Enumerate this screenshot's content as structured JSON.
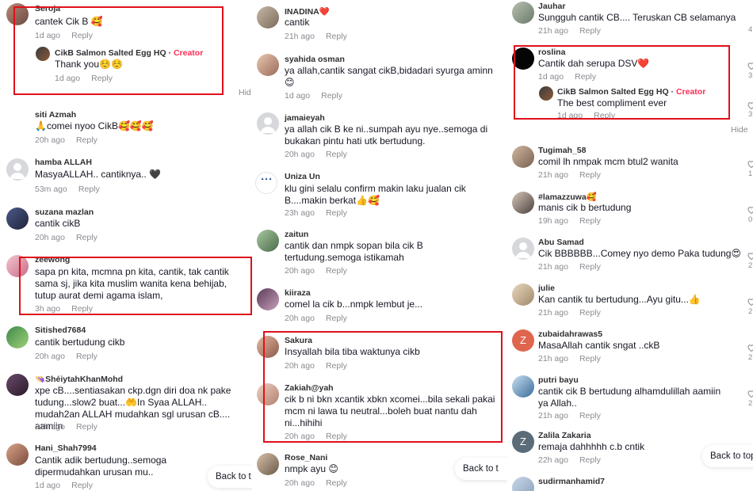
{
  "colors": {
    "highlight": "#e0101a",
    "creator": "#fe2c55",
    "meta": "#8a8b91"
  },
  "col1": {
    "comments": [
      {
        "user": "Seroja",
        "text": "cantek Cik B 🥰",
        "time": "1d ago",
        "reply": "Reply",
        "sub": {
          "user": "CikB Salmon Salted Egg HQ",
          "badge": "Creator",
          "text": "Thank you☺️☺️",
          "time": "1d ago",
          "reply": "Reply"
        }
      },
      {
        "user": "siti Azmah",
        "text": "🙏comei nyoo CikB🥰🥰🥰",
        "time": "20h ago",
        "reply": "Reply"
      },
      {
        "user": "hamba ALLAH",
        "text": "MasyaALLAH.. cantiknya.. 🖤",
        "time": "53m ago",
        "reply": "Reply"
      },
      {
        "user": "suzana mazlan",
        "text": "cantik cikB",
        "time": "20h ago",
        "reply": "Reply"
      },
      {
        "user": "zeewong",
        "text": "sapa pn kita, mcmna pn kita, cantik, tak cantik sama sj, jika kita muslim wanita kena behijab, tutup aurat demi agama islam,",
        "time": "3h ago",
        "reply": "Reply"
      },
      {
        "user": "Sitished7684",
        "text": "cantik bertudung cikb",
        "time": "20h ago",
        "reply": "Reply"
      },
      {
        "user": "👒ShéiytahKhanMohd",
        "text": "xpe cB....sentiasakan ckp.dgn diri doa nk pake tudung...slow2 buat...🤲In Syaa ALLAH.. mudah2an ALLAH mudahkan sgl urusan cB.... aamiin",
        "time": "21h ago",
        "reply": "Reply"
      },
      {
        "user": "Hani_Shah7994",
        "text": "Cantik adik bertudung..semoga dipermudahkan urusan mu..",
        "time": "1d ago",
        "reply": "Reply"
      }
    ],
    "hide": "Hid",
    "back": "Back to t"
  },
  "col2": {
    "comments": [
      {
        "user": "INADINA❤️",
        "text": "cantik",
        "time": "21h ago",
        "reply": "Reply"
      },
      {
        "user": "syahida osman",
        "text": "ya allah,cantik sangat cikB,bidadari syurga aminn 😊",
        "time": "1d ago",
        "reply": "Reply"
      },
      {
        "user": "jamaieyah",
        "text": "ya allah cik B ke ni..sumpah ayu nye..semoga di bukakan pintu hati utk bertudung.",
        "time": "20h ago",
        "reply": "Reply"
      },
      {
        "user": "Uniza Un",
        "text": "klu gini selalu confirm makin laku jualan cik B....makin berkat👍🥰",
        "time": "23h ago",
        "reply": "Reply"
      },
      {
        "user": "zaitun",
        "text": "cantik dan nmpk sopan bila cik B tertudung.semoga istikamah",
        "time": "20h ago",
        "reply": "Reply"
      },
      {
        "user": "kiiraza",
        "text": "comel la cik b...nmpk lembut je...",
        "time": "20h ago",
        "reply": "Reply"
      },
      {
        "user": "Sakura",
        "text": "Insyallah bila tiba waktunya cikb",
        "time": "20h ago",
        "reply": "Reply"
      },
      {
        "user": "Zakiah@yah",
        "text": "cik b ni bkn xcantik xbkn xcomei...bila sekali pakai mcm ni lawa tu neutral...boleh buat nantu dah ni...hihihi",
        "time": "20h ago",
        "reply": "Reply"
      },
      {
        "user": "Rose_Nani",
        "text": "nmpk ayu 😊",
        "time": "20h ago",
        "reply": "Reply"
      }
    ],
    "back": "Back to t"
  },
  "col3": {
    "comments": [
      {
        "user": "Jauhar",
        "text": "Sungguh cantik CB.... Teruskan CB selamanya",
        "time": "21h ago",
        "reply": "Reply",
        "likes": "4"
      },
      {
        "user": "roslina",
        "text": "Cantik dah serupa DSV❤️",
        "time": "1d ago",
        "reply": "Reply",
        "likes": "3",
        "sub": {
          "user": "CikB Salmon Salted Egg HQ",
          "badge": "Creator",
          "text": "The best compliment ever",
          "time": "1d ago",
          "reply": "Reply",
          "likes": "3"
        }
      },
      {
        "user": "Tugimah_58",
        "text": "comil lh nmpak mcm btul2 wanita",
        "time": "21h ago",
        "reply": "Reply",
        "likes": "1"
      },
      {
        "user": "#lamazzuwa🥰",
        "text": "manis cik b bertudung",
        "time": "19h ago",
        "reply": "Reply",
        "likes": "0"
      },
      {
        "user": "Abu Samad",
        "text": "Cik BBBBBB...Comey nyo demo Paka tudung😍",
        "time": "21h ago",
        "reply": "Reply",
        "likes": "2"
      },
      {
        "user": "julie",
        "text": "Kan cantik tu bertudung...Ayu gitu...👍",
        "time": "21h ago",
        "reply": "Reply",
        "likes": "2"
      },
      {
        "user": "zubaidahrawas5",
        "text": "MasaAllah cantik sngat ..ckB",
        "time": "21h ago",
        "reply": "Reply",
        "likes": "2"
      },
      {
        "user": "putri bayu",
        "text": "cantik cik B bertudung alhamdulillah aamiin ya Allah..",
        "time": "21h ago",
        "reply": "Reply",
        "likes": "2"
      },
      {
        "user": "Zalila Zakaria",
        "text": "remaja dahhhhh c.b cntik",
        "time": "22h ago",
        "reply": "Reply"
      },
      {
        "user": "sudirmanhamid7",
        "text": "",
        "time": "",
        "reply": ""
      }
    ],
    "hide": "Hide",
    "back": "Back to top"
  }
}
